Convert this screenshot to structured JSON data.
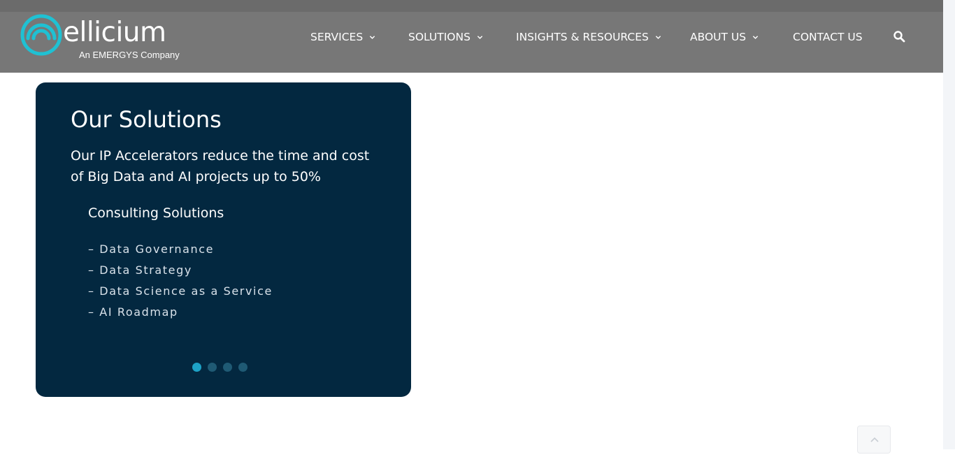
{
  "brand": {
    "name": "ellicium",
    "tagline": "An EMERGYS Company",
    "accent_color": "#1fc1d3"
  },
  "nav": {
    "items": [
      {
        "label": "SERVICES",
        "has_dropdown": true
      },
      {
        "label": "SOLUTIONS",
        "has_dropdown": true
      },
      {
        "label": "INSIGHTS & RESOURCES",
        "has_dropdown": true
      },
      {
        "label": "ABOUT US",
        "has_dropdown": true
      },
      {
        "label": "CONTACT US",
        "has_dropdown": false
      }
    ],
    "search_icon": "search-icon"
  },
  "card": {
    "title": "Our Solutions",
    "subtitle": "Our IP Accelerators reduce the time and cost of Big Data and AI projects up to 50%",
    "section_title": "Consulting Solutions",
    "items": [
      "– Data Governance",
      "– Data Strategy",
      "– Data Science as a Service",
      "– AI Roadmap"
    ],
    "slide_count": 4,
    "active_slide": 1,
    "background": "#032840"
  },
  "back_to_top_icon": "chevron-up-icon"
}
